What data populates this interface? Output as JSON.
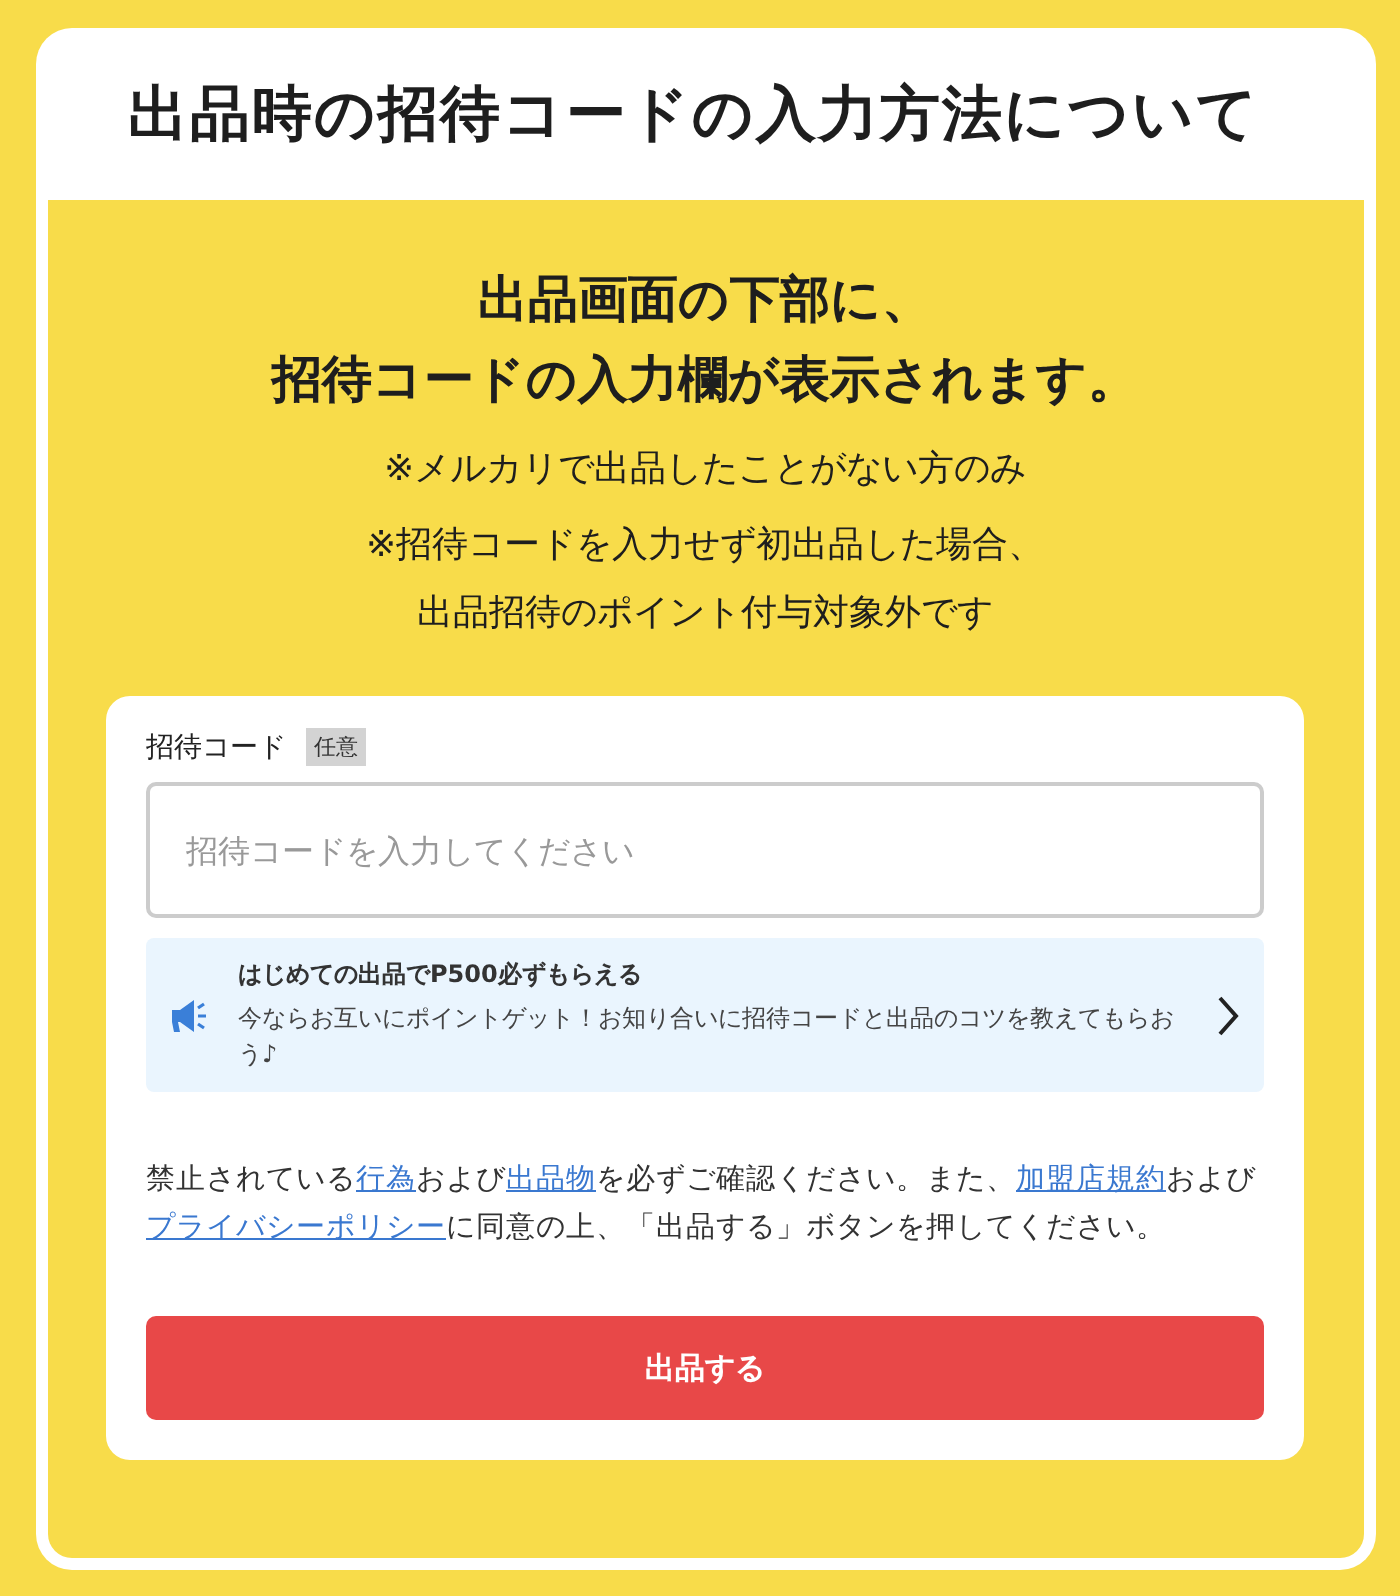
{
  "title": "出品時の招待コードの入力方法について",
  "headline": [
    "出品画面の下部に、",
    "招待コードの入力欄が表示されます。"
  ],
  "notes": [
    "※メルカリで出品したことがない方のみ",
    "※招待コードを入力せず初出品した場合、",
    "出品招待のポイント付与対象外です"
  ],
  "form": {
    "label": "招待コード",
    "badge": "任意",
    "placeholder": "招待コードを入力してください",
    "banner": {
      "title": "はじめての出品でP500必ずもらえる",
      "text": "今ならお互いにポイントゲット！お知り合いに招待コードと出品のコツを教えてもらおう♪"
    },
    "agreement": [
      {
        "kind": "text",
        "text": "禁止されている"
      },
      {
        "kind": "link",
        "text": "行為"
      },
      {
        "kind": "text",
        "text": "および"
      },
      {
        "kind": "link",
        "text": "出品物"
      },
      {
        "kind": "text",
        "text": "を必ずご確認ください。また、"
      },
      {
        "kind": "link",
        "text": "加盟店規約"
      },
      {
        "kind": "text",
        "text": "および"
      },
      {
        "kind": "link",
        "text": "プライバシーポリシー"
      },
      {
        "kind": "text",
        "text": "に同意の上、「出品する」ボタンを押してください。"
      }
    ],
    "button": "出品する"
  }
}
